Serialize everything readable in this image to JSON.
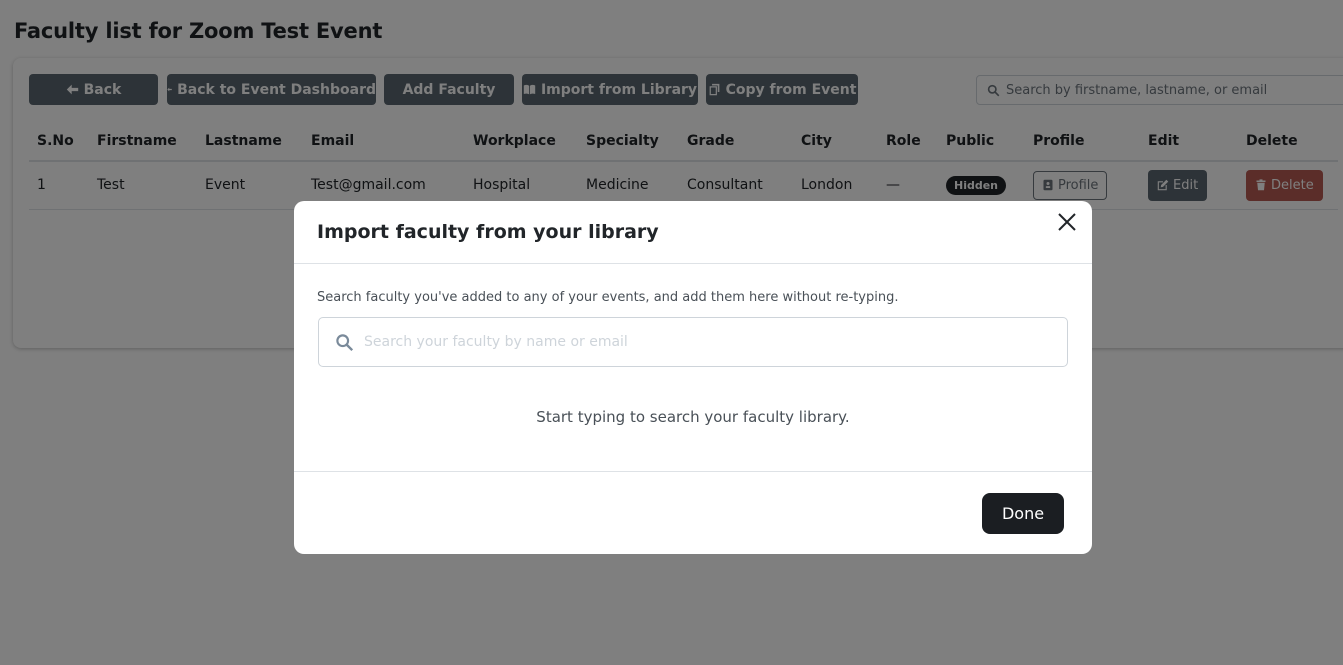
{
  "page": {
    "title": "Faculty list for Zoom Test Event"
  },
  "toolbar": {
    "back_label": "Back",
    "event_dashboard_label": "Back to Event Dashboard",
    "add_faculty_label": "Add Faculty",
    "import_library_label": "Import from Library",
    "copy_event_label": "Copy from Event",
    "search_placeholder": "Search by firstname, lastname, or email"
  },
  "table": {
    "headers": [
      "S.No",
      "Firstname",
      "Lastname",
      "Email",
      "Workplace",
      "Specialty",
      "Grade",
      "City",
      "Role",
      "Public",
      "Profile",
      "Edit",
      "Delete"
    ],
    "rows": [
      {
        "sno": "1",
        "firstname": "Test",
        "lastname": "Event",
        "email": "Test@gmail.com",
        "workplace": "Hospital",
        "specialty": "Medicine",
        "grade": "Consultant",
        "city": "London",
        "role": "—",
        "public": "Hidden",
        "profile_label": "Profile",
        "edit_label": "Edit",
        "delete_label": "Delete"
      }
    ]
  },
  "modal": {
    "title": "Import faculty from your library",
    "description": "Search faculty you've added to any of your events, and add them here without re-typing.",
    "search_placeholder": "Search your faculty by name or email",
    "empty_message": "Start typing to search your faculty library.",
    "done_label": "Done"
  },
  "colors": {
    "overlay": "rgba(0,0,0,0.5)",
    "dark_button": "#5b6770",
    "delete_button": "#b65a52",
    "done_button": "#1b1e22"
  }
}
